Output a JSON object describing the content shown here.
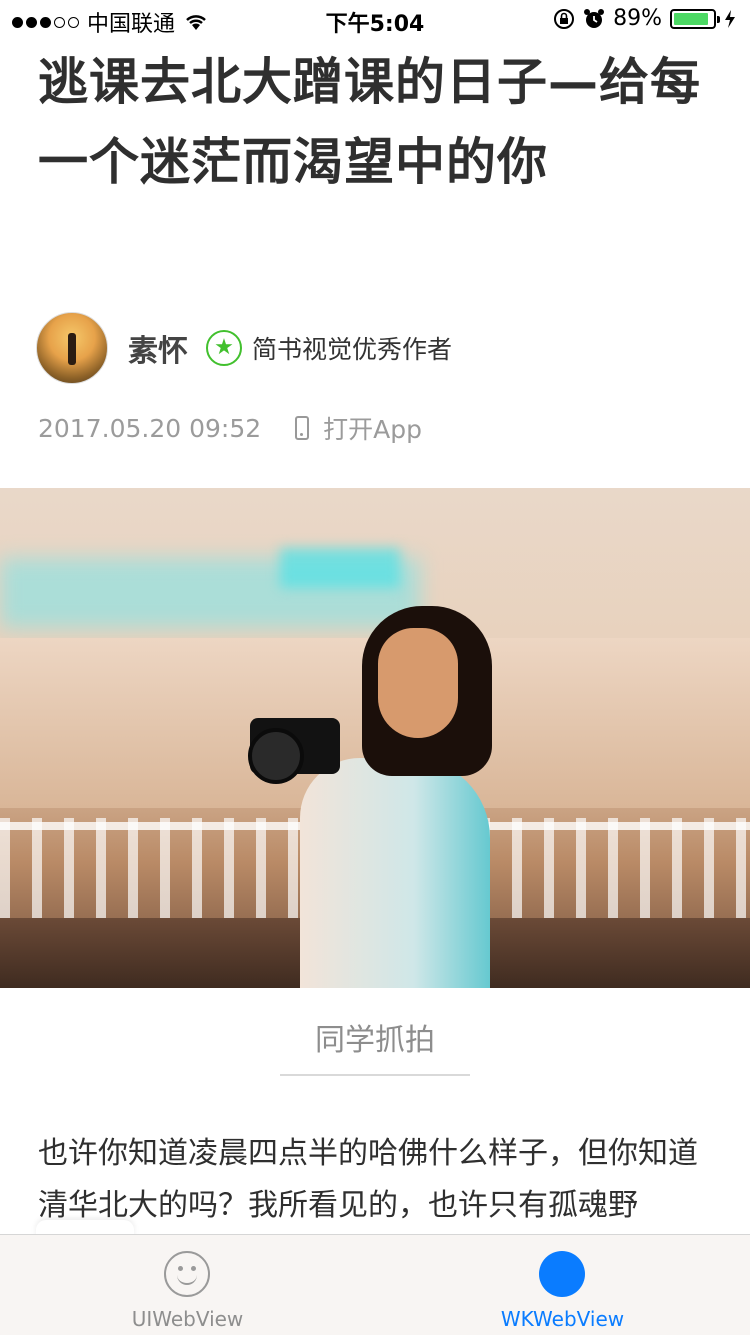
{
  "status_bar": {
    "carrier": "中国联通",
    "time": "下午5:04",
    "battery_percent": "89%",
    "battery_level": 0.89,
    "signal_strength": 3,
    "signal_max": 5
  },
  "article": {
    "title": "逃课去北大蹭课的日子—给每一个迷茫而渴望中的你",
    "author_name": "素怀",
    "author_badge": "简书视觉优秀作者",
    "timestamp": "2017.05.20 09:52",
    "open_app": "打开App",
    "image_caption": "同学抓拍",
    "body": "也许你知道凌晨四点半的哈佛什么样子，但你知道清华北大的吗？我所看见的，也许只有孤魂野"
  },
  "tab_bar": {
    "tabs": [
      {
        "label": "UIWebView",
        "icon": "smiley-icon",
        "active": false
      },
      {
        "label": "WKWebView",
        "icon": "blue-circle-icon",
        "active": true
      }
    ]
  },
  "colors": {
    "accent": "#0a7cff",
    "badge_green": "#42c02e",
    "battery_green": "#4cd964"
  }
}
